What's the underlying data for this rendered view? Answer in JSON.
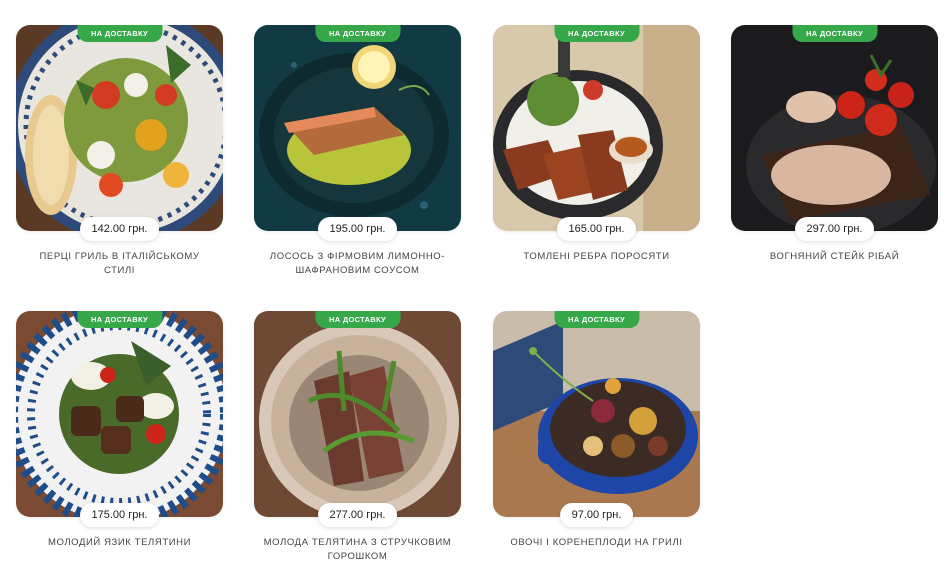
{
  "products": [
    {
      "badge": "НА ДОСТАВКУ",
      "price": "142.00 грн.",
      "name": "ПЕРЦІ ГРИЛЬ В ІТАЛІЙСЬКОМУ СТИЛІ"
    },
    {
      "badge": "НА ДОСТАВКУ",
      "price": "195.00 грн.",
      "name": "ЛОСОСЬ З ФІРМОВИМ ЛИМОННО-ШАФРАНОВИМ СОУСОМ"
    },
    {
      "badge": "НА ДОСТАВКУ",
      "price": "165.00 грн.",
      "name": "ТОМЛЕНІ РЕБРА ПОРОСЯТИ"
    },
    {
      "badge": "НА ДОСТАВКУ",
      "price": "297.00 грн.",
      "name": "ВОГНЯНИЙ СТЕЙК РІБАЙ"
    },
    {
      "badge": "НА ДОСТАВКУ",
      "price": "175.00 грн.",
      "name": "МОЛОДИЙ ЯЗИК ТЕЛЯТИНИ"
    },
    {
      "badge": "НА ДОСТАВКУ",
      "price": "277.00 грн.",
      "name": "МОЛОДА ТЕЛЯТИНА З СТРУЧКОВИМ ГОРОШКОМ"
    },
    {
      "badge": "НА ДОСТАВКУ",
      "price": "97.00 грн.",
      "name": "ОВОЧІ І КОРЕНЕПЛОДИ НА ГРИЛІ"
    }
  ]
}
